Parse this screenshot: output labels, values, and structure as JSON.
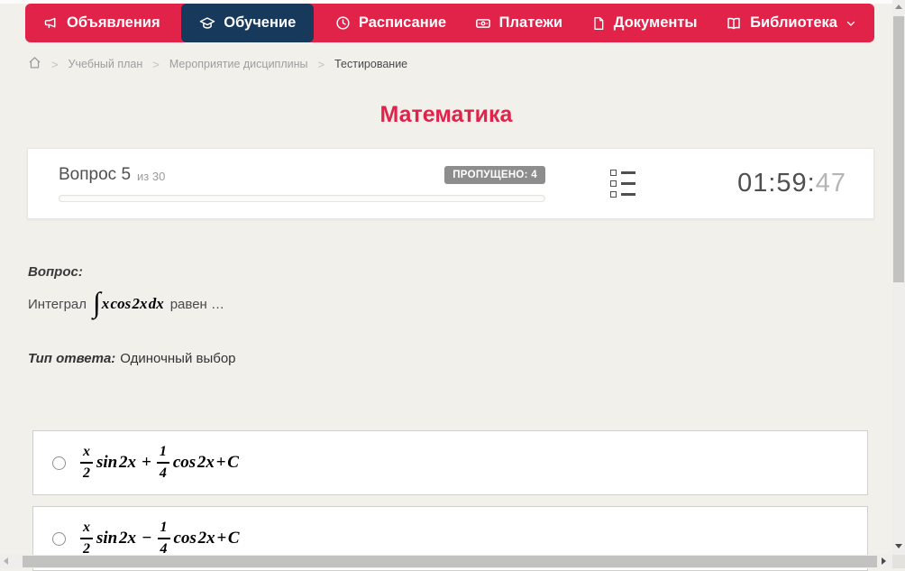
{
  "colors": {
    "nav_red": "#e22349",
    "active_navy": "#17395c",
    "page_bg": "#f1f0eb",
    "title_red": "#e0234a",
    "badge_bg": "#8d8d8d"
  },
  "nav": {
    "items": [
      {
        "label": "Объявления",
        "icon": "megaphone-icon",
        "active": false
      },
      {
        "label": "Обучение",
        "icon": "graduation-cap-icon",
        "active": true
      },
      {
        "label": "Расписание",
        "icon": "clock-icon",
        "active": false
      },
      {
        "label": "Платежи",
        "icon": "banknote-icon",
        "active": false
      },
      {
        "label": "Документы",
        "icon": "document-icon",
        "active": false
      },
      {
        "label": "Библиотека",
        "icon": "open-book-icon",
        "active": false,
        "has_dropdown": true
      }
    ]
  },
  "breadcrumb": {
    "home_icon": "home-icon",
    "items": [
      "Учебный план",
      "Мероприятие дисциплины",
      "Тестирование"
    ]
  },
  "page": {
    "title": "Математика"
  },
  "question_header": {
    "question_label": "Вопрос 5",
    "question_of": "из 30",
    "skipped_badge": "ПРОПУЩЕНО: 4",
    "progress_percent": 0,
    "timer_hm": "01:59:",
    "timer_seconds": "47"
  },
  "question": {
    "label": "Вопрос:",
    "text_before": "Интеграл",
    "formula_integral": "∫",
    "formula_body": "x cos 2x dx",
    "text_after": "равен …",
    "type_label": "Тип ответа:",
    "type_value": "Одиночный выбор"
  },
  "options": [
    {
      "frac1_num": "x",
      "frac1_den": "2",
      "term1": "sin 2x",
      "operator": "+",
      "frac2_num": "1",
      "frac2_den": "4",
      "term2": "cos 2x + C"
    },
    {
      "frac1_num": "x",
      "frac1_den": "2",
      "term1": "sin 2x",
      "operator": "−",
      "frac2_num": "1",
      "frac2_den": "4",
      "term2": "cos 2x + C"
    }
  ]
}
